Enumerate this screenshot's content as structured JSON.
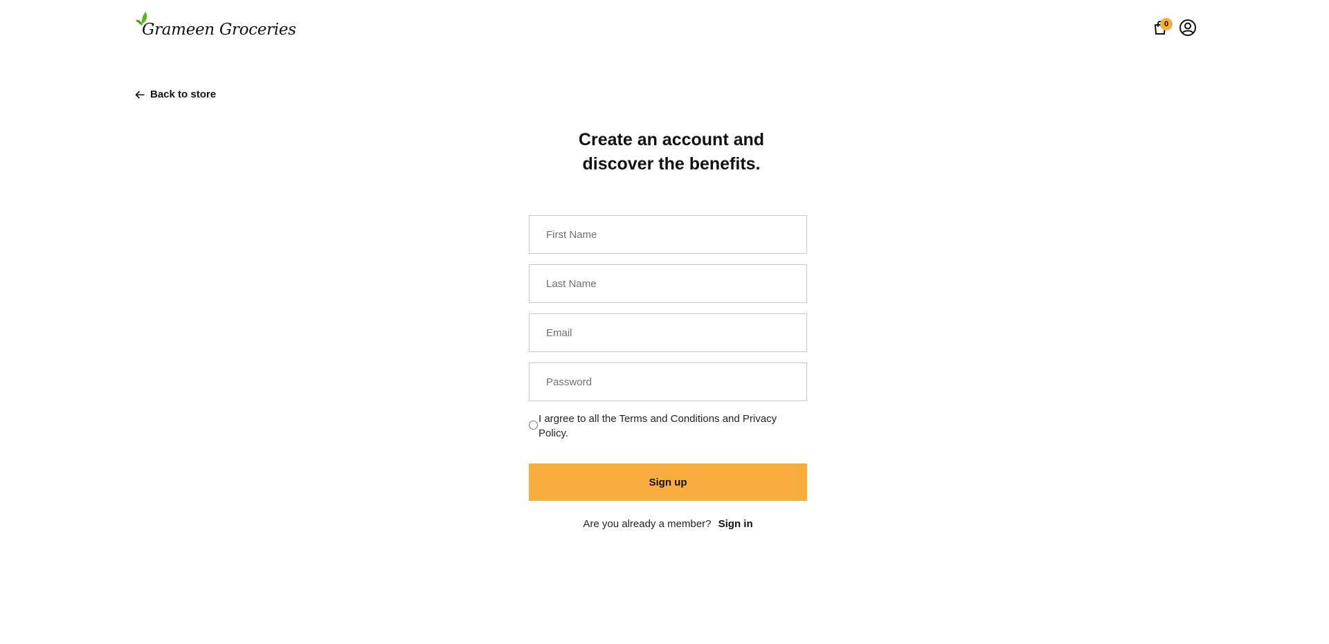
{
  "header": {
    "brand": "Grameen Groceries",
    "logo_icon": "leaf-icon",
    "cart_icon": "shopping-bag-icon",
    "cart_count": "0",
    "account_icon": "user-circle-icon"
  },
  "nav": {
    "back_label": "Back to store",
    "back_icon": "arrow-left-icon"
  },
  "main": {
    "title_line1": "Create an account and",
    "title_line2": "discover the benefits."
  },
  "form": {
    "first_name_placeholder": "First Name",
    "first_name_value": "",
    "last_name_placeholder": "Last Name",
    "last_name_value": "",
    "email_placeholder": "Email",
    "email_value": "",
    "password_placeholder": "Password",
    "password_value": "",
    "agree_text": "I argree to all the Terms and Conditions and Privacy Policy.",
    "agree_checked": false,
    "submit_label": "Sign up",
    "member_prompt": "Are you already a member?",
    "signin_label": "Sign in"
  },
  "colors": {
    "accent": "#f9ad3d",
    "leaf": "#5fb418",
    "text": "#111111",
    "border": "#c9c9c9"
  }
}
